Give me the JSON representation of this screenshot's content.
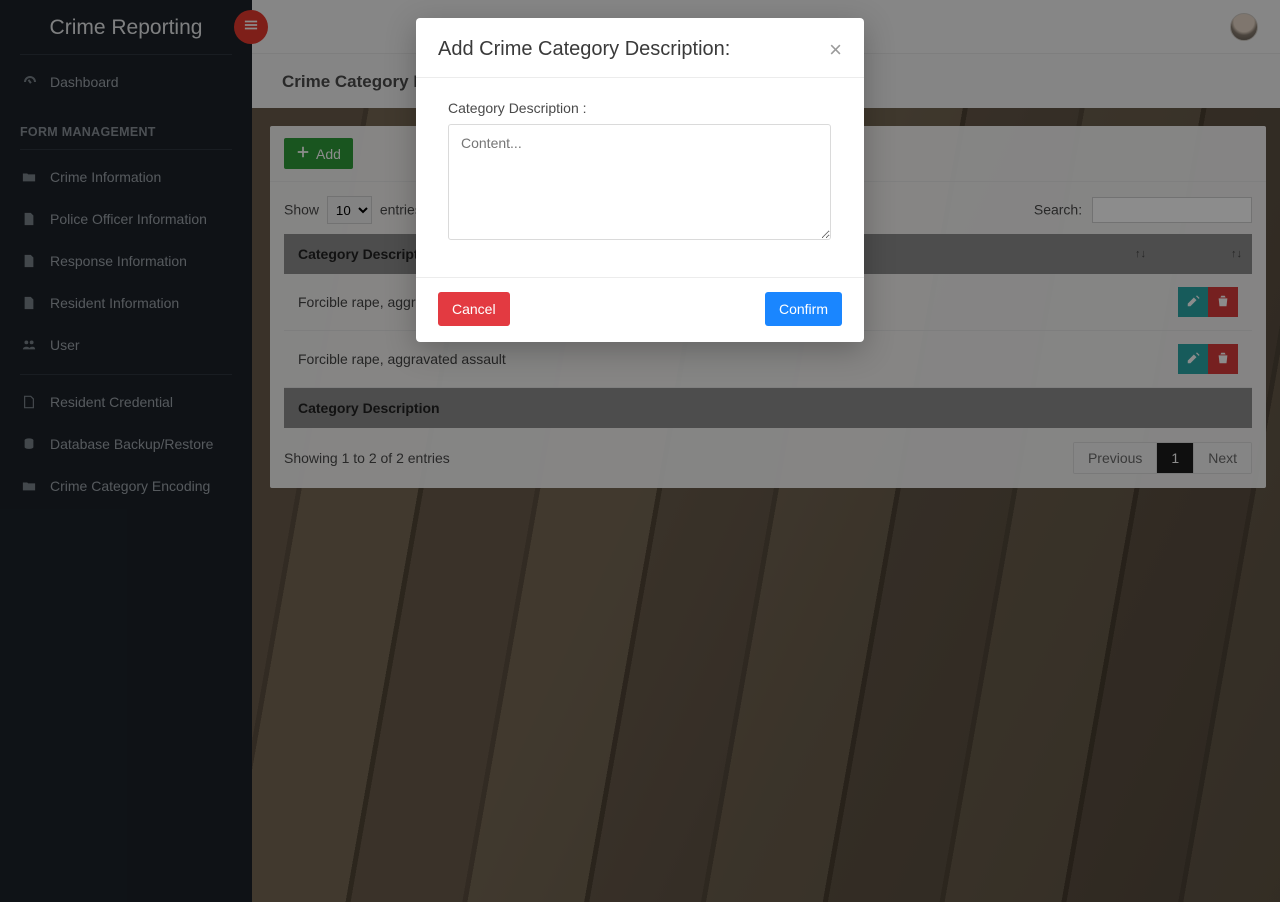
{
  "app": {
    "title": "Crime Reporting"
  },
  "sidebar": {
    "dashboard_label": "Dashboard",
    "section_label": "FORM MANAGEMENT",
    "items": [
      {
        "label": "Crime Information"
      },
      {
        "label": "Police Officer Information"
      },
      {
        "label": "Response Information"
      },
      {
        "label": "Resident Information"
      },
      {
        "label": "User"
      }
    ],
    "items2": [
      {
        "label": "Resident Credential"
      },
      {
        "label": "Database Backup/Restore"
      },
      {
        "label": "Crime Category Encoding"
      }
    ]
  },
  "page": {
    "title": "Crime Category Encoding"
  },
  "panel": {
    "add_label": "Add",
    "len_prefix": "Show",
    "len_value": "10",
    "len_suffix": "entries",
    "search_label": "Search:",
    "search_value": "",
    "col_header": "Category Description",
    "sort_glyph": "↑↓",
    "rows": [
      {
        "desc": "Forcible rape, aggravated assault"
      },
      {
        "desc": "Forcible rape, aggravated assault"
      }
    ],
    "foot_header": "Category Description",
    "info": "Showing 1 to 2 of 2 entries",
    "prev_label": "Previous",
    "page_num": "1",
    "next_label": "Next"
  },
  "modal": {
    "title": "Add Crime Category Description:",
    "close_glyph": "×",
    "field_label": "Category Description :",
    "placeholder": "Content...",
    "value": "",
    "cancel_label": "Cancel",
    "confirm_label": "Confirm"
  }
}
